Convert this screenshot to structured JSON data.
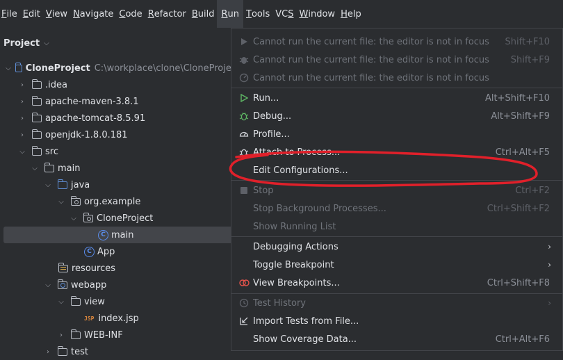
{
  "menubar": {
    "items": [
      "File",
      "Edit",
      "View",
      "Navigate",
      "Code",
      "Refactor",
      "Build",
      "Run",
      "Tools",
      "VCS",
      "Window",
      "Help"
    ],
    "underline": [
      "F",
      "E",
      "V",
      "N",
      "C",
      "R",
      "B",
      "R",
      "T",
      "S",
      "W",
      "H"
    ]
  },
  "project_panel": {
    "title": "Project",
    "root_name": "CloneProject",
    "root_path": "C:\\workplace\\clone\\CloneProjec",
    "nodes": {
      "idea": ".idea",
      "maven": "apache-maven-3.8.1",
      "tomcat": "apache-tomcat-8.5.91",
      "jdk": "openjdk-1.8.0.181",
      "src": "src",
      "main": "main",
      "java": "java",
      "org_example": "org.example",
      "cloneproject_pkg": "CloneProject",
      "main_class": "main",
      "app_class": "App",
      "resources": "resources",
      "webapp": "webapp",
      "view": "view",
      "index_jsp": "index.jsp",
      "web_inf": "WEB-INF",
      "test": "test"
    },
    "class_icon_letter": "C",
    "jsp_icon_text": "JSP"
  },
  "run_menu": {
    "items": [
      {
        "id": "cannot-run",
        "label": "Cannot run the current file: the editor is not in focus",
        "shortcut": "Shift+F10",
        "disabled": true
      },
      {
        "id": "cannot-debug",
        "label": "Cannot run the current file: the editor is not in focus",
        "shortcut": "Shift+F9",
        "disabled": true
      },
      {
        "id": "cannot-profile",
        "label": "Cannot run the current file: the editor is not in focus",
        "shortcut": "",
        "disabled": true
      },
      {
        "id": "run",
        "label": "Run...",
        "shortcut": "Alt+Shift+F10",
        "disabled": false
      },
      {
        "id": "debug",
        "label": "Debug...",
        "shortcut": "Alt+Shift+F9",
        "disabled": false
      },
      {
        "id": "profile",
        "label": "Profile...",
        "shortcut": "",
        "disabled": false
      },
      {
        "id": "attach",
        "label": "Attach to Process...",
        "shortcut": "Ctrl+Alt+F5",
        "disabled": false
      },
      {
        "id": "edit-config",
        "label": "Edit Configurations...",
        "shortcut": "",
        "disabled": false
      },
      {
        "id": "stop",
        "label": "Stop",
        "shortcut": "Ctrl+F2",
        "disabled": true
      },
      {
        "id": "stop-bg",
        "label": "Stop Background Processes...",
        "shortcut": "Ctrl+Shift+F2",
        "disabled": true
      },
      {
        "id": "show-running",
        "label": "Show Running List",
        "shortcut": "",
        "disabled": true
      },
      {
        "id": "debugging-actions",
        "label": "Debugging Actions",
        "shortcut": "",
        "disabled": false
      },
      {
        "id": "toggle-breakpoint",
        "label": "Toggle Breakpoint",
        "shortcut": "",
        "disabled": false
      },
      {
        "id": "view-breakpoints",
        "label": "View Breakpoints...",
        "shortcut": "Ctrl+Shift+F8",
        "disabled": false
      },
      {
        "id": "test-history",
        "label": "Test History",
        "shortcut": "",
        "disabled": true
      },
      {
        "id": "import-tests",
        "label": "Import Tests from File...",
        "shortcut": "",
        "disabled": false
      },
      {
        "id": "show-coverage",
        "label": "Show Coverage Data...",
        "shortcut": "Ctrl+Alt+F6",
        "disabled": false
      }
    ],
    "submenu_arrow": "›"
  },
  "colors": {
    "background": "#2b2d30",
    "selection": "#43454a",
    "annotation": "#e0202a",
    "run_green": "#5fb865",
    "breakpoint_red": "#e5534b"
  }
}
